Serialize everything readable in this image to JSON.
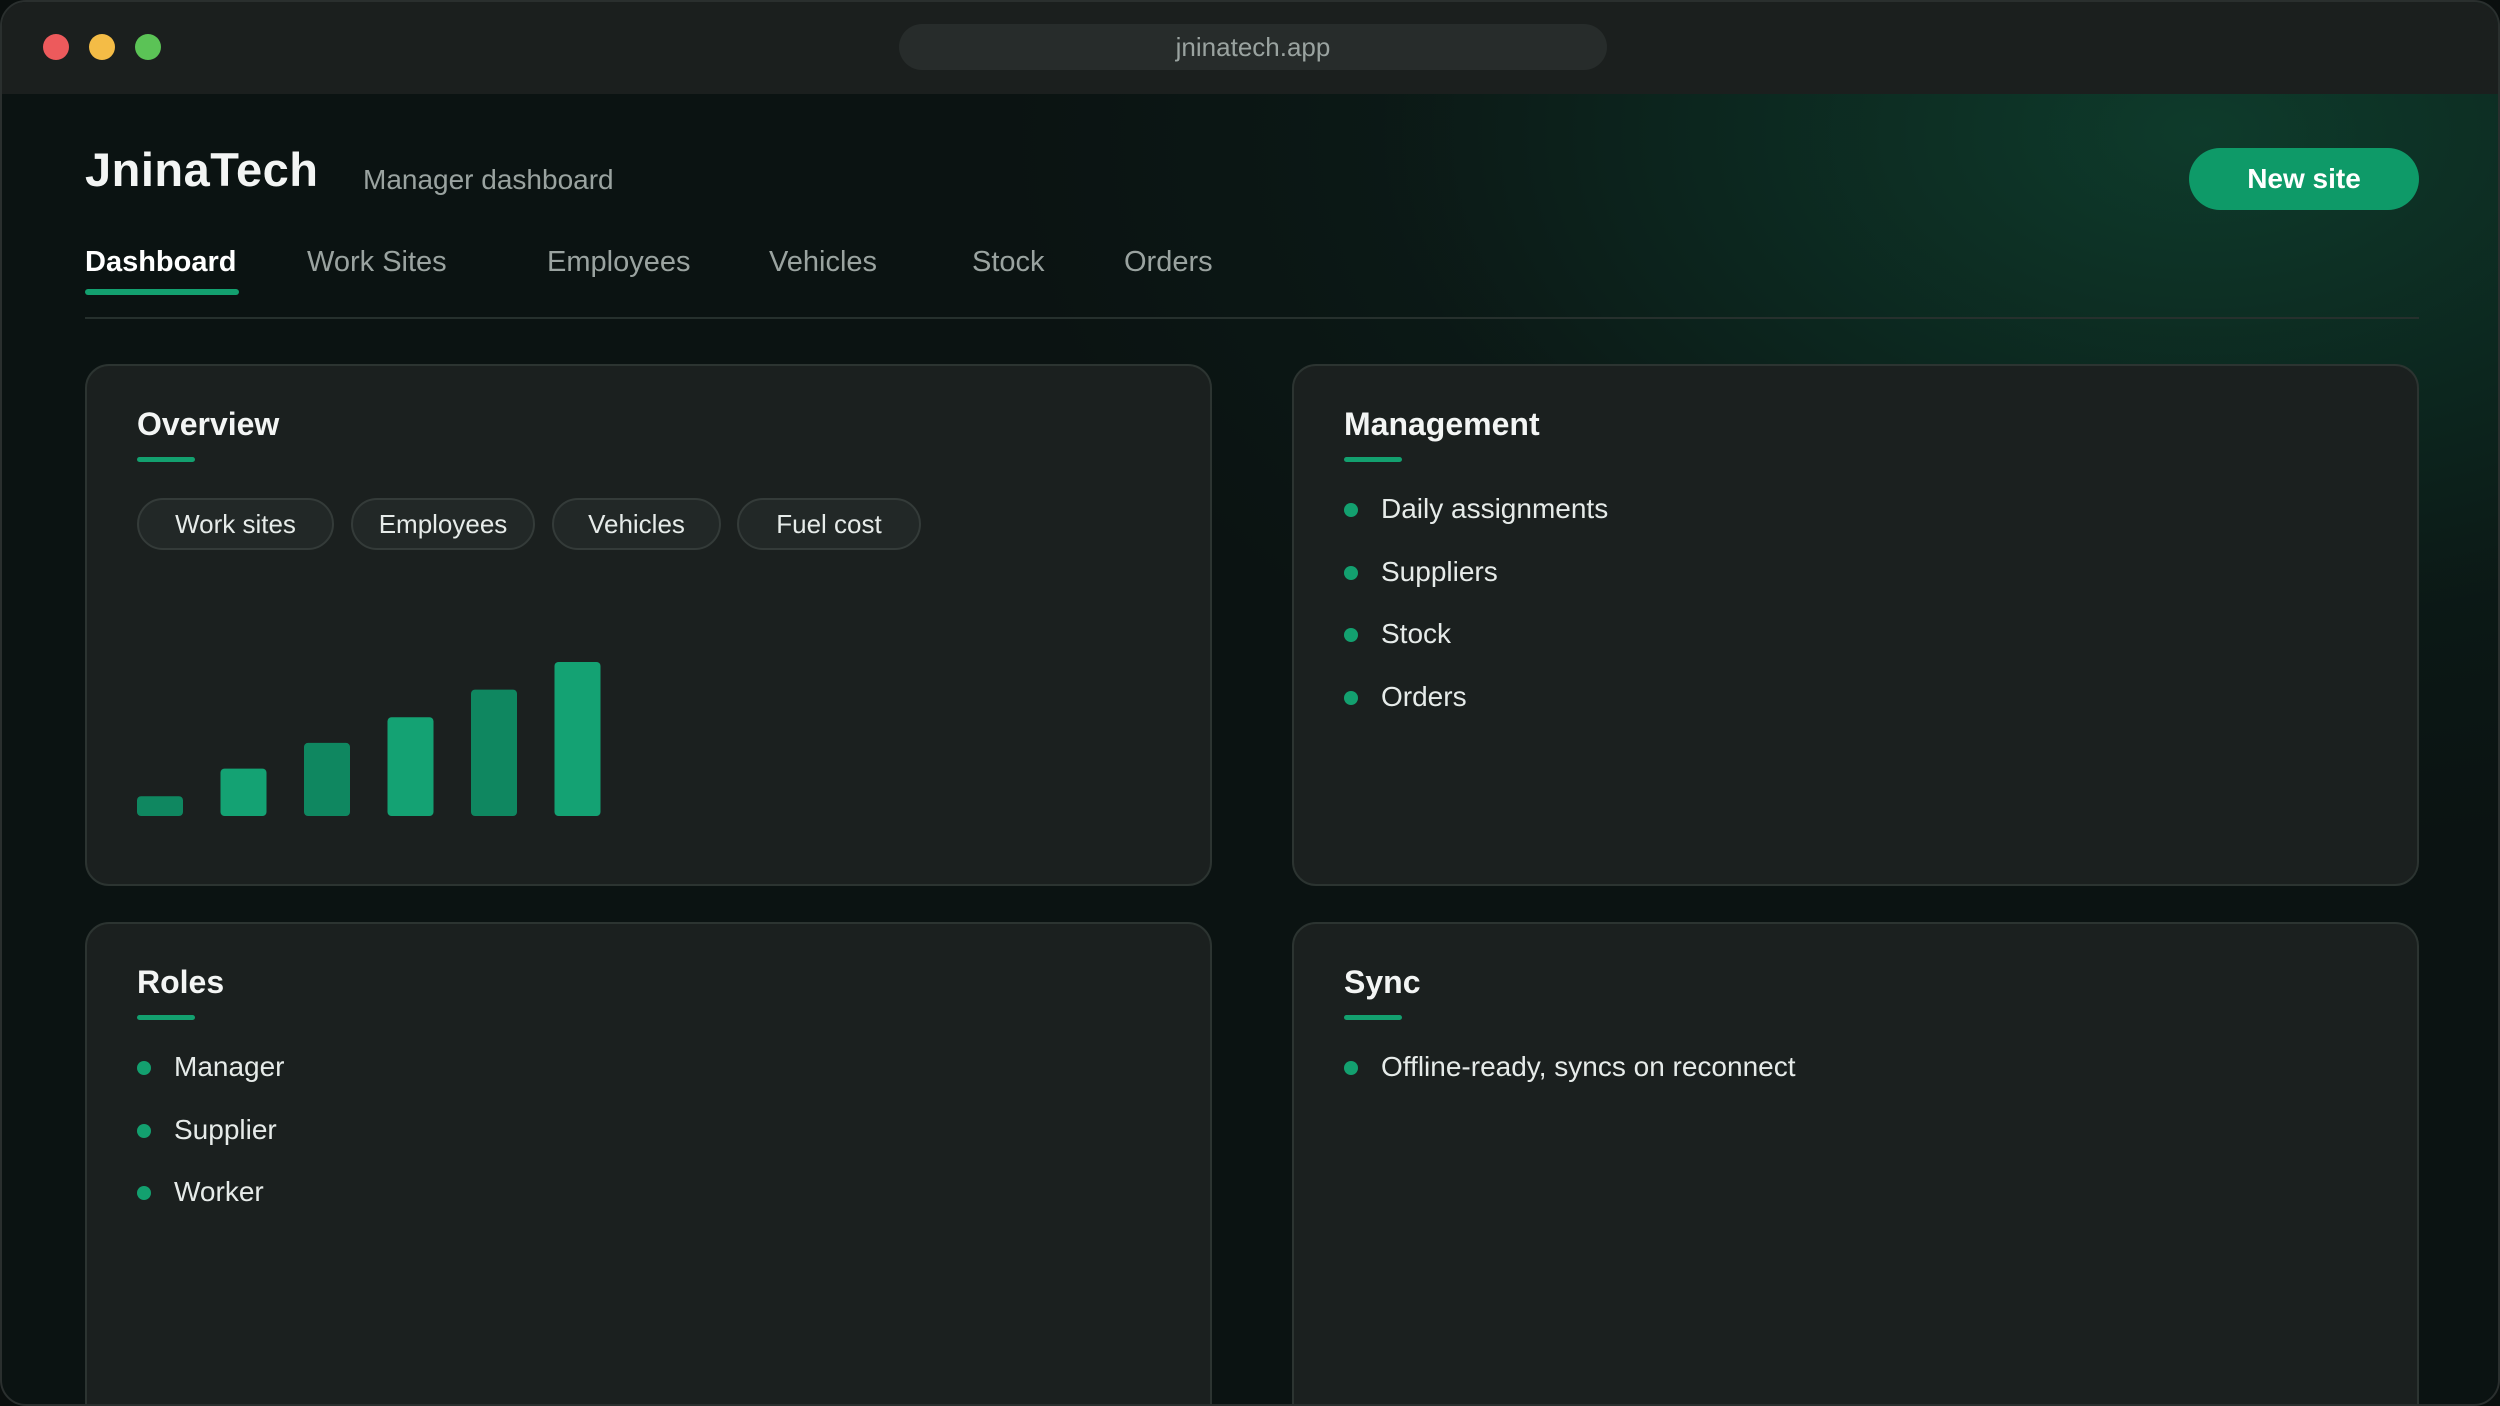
{
  "window": {
    "url": "jninatech.app"
  },
  "header": {
    "brand": "JninaTech",
    "subtitle": "Manager dashboard",
    "primary_action": "New site"
  },
  "tabs": [
    {
      "label": "Dashboard",
      "active": true
    },
    {
      "label": "Work Sites",
      "active": false
    },
    {
      "label": "Employees",
      "active": false
    },
    {
      "label": "Vehicles",
      "active": false
    },
    {
      "label": "Stock",
      "active": false
    },
    {
      "label": "Orders",
      "active": false
    }
  ],
  "overview": {
    "title": "Overview",
    "chips": [
      "Work sites",
      "Employees",
      "Vehicles",
      "Fuel cost"
    ]
  },
  "management": {
    "title": "Management",
    "items": [
      "Daily assignments",
      "Suppliers",
      "Stock",
      "Orders"
    ]
  },
  "roles": {
    "title": "Roles",
    "items": [
      "Manager",
      "Supplier",
      "Worker"
    ]
  },
  "sync": {
    "title": "Sync",
    "items": [
      "Offline-ready, syncs on reconnect"
    ]
  },
  "chart_data": {
    "type": "bar",
    "categories": [
      "",
      "",
      "",
      "",
      "",
      ""
    ],
    "values": [
      1,
      2.4,
      3.7,
      5.0,
      6.4,
      7.8
    ],
    "ylim": [
      0,
      8
    ],
    "grid": false,
    "colors": [
      "#0f8760",
      "#14a273",
      "#0f8760",
      "#14a273",
      "#0f8760",
      "#14a273"
    ]
  },
  "theme": {
    "accent": "#13a06f",
    "button": "#0e9a68"
  }
}
